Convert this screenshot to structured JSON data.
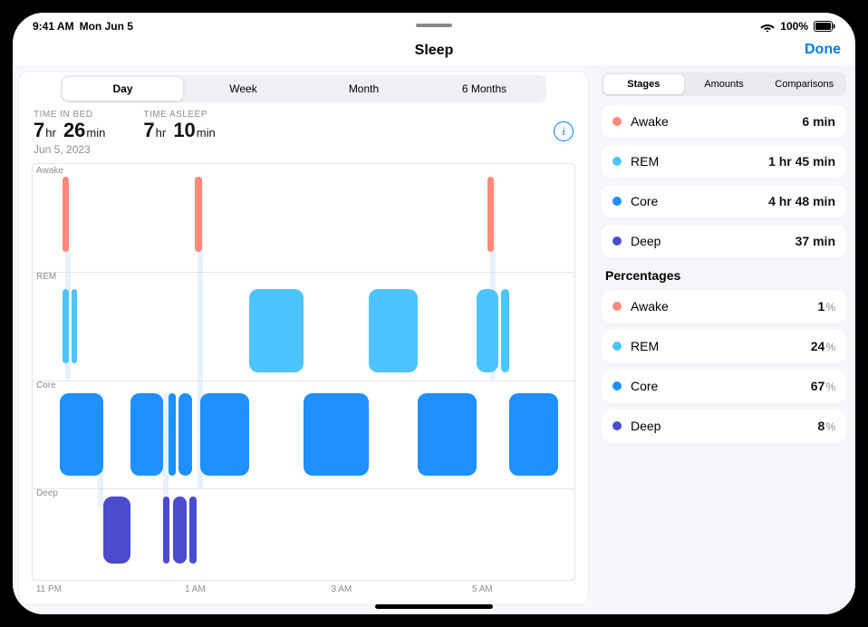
{
  "status": {
    "time": "9:41 AM",
    "date": "Mon Jun 5",
    "battery": "100%"
  },
  "header": {
    "title": "Sleep",
    "done": "Done"
  },
  "range_tabs": [
    "Day",
    "Week",
    "Month",
    "6 Months"
  ],
  "range_active": 0,
  "metrics": {
    "bed_label": "TIME IN BED",
    "bed_hr": "7",
    "bed_hr_u": "hr",
    "bed_min": "26",
    "bed_min_u": "min",
    "asleep_label": "TIME ASLEEP",
    "asleep_hr": "7",
    "asleep_hr_u": "hr",
    "asleep_min": "10",
    "asleep_min_u": "min",
    "date": "Jun 5, 2023"
  },
  "axis": {
    "ylabels": [
      "Awake",
      "REM",
      "Core",
      "Deep"
    ],
    "xlabels": [
      "11 PM",
      "1 AM",
      "3 AM",
      "5 AM"
    ]
  },
  "side_tabs": [
    "Stages",
    "Amounts",
    "Comparisons"
  ],
  "side_active": 0,
  "stages": [
    {
      "name": "Awake",
      "color": "#ff8a7a",
      "val": "6 min"
    },
    {
      "name": "REM",
      "color": "#4dc4ff",
      "val": "1 hr 45 min"
    },
    {
      "name": "Core",
      "color": "#1e90ff",
      "val": "4 hr 48 min"
    },
    {
      "name": "Deep",
      "color": "#4b4bcf",
      "val": "37 min"
    }
  ],
  "pct_title": "Percentages",
  "percentages": [
    {
      "name": "Awake",
      "color": "#ff8a7a",
      "val": "1"
    },
    {
      "name": "REM",
      "color": "#4dc4ff",
      "val": "24"
    },
    {
      "name": "Core",
      "color": "#1e90ff",
      "val": "67"
    },
    {
      "name": "Deep",
      "color": "#4b4bcf",
      "val": "8"
    }
  ],
  "pct_unit": "%",
  "chart_data": {
    "type": "timeline-stage",
    "title": "Sleep",
    "x_start": "23:00",
    "x_end": "06:30",
    "stages_order": [
      "Awake",
      "REM",
      "Core",
      "Deep"
    ],
    "xticks": [
      "11 PM",
      "1 AM",
      "3 AM",
      "5 AM"
    ],
    "segments": [
      {
        "stage": "Awake",
        "start": "23:10",
        "end": "23:13"
      },
      {
        "stage": "REM",
        "start": "23:14",
        "end": "23:18"
      },
      {
        "stage": "Core",
        "start": "23:18",
        "end": "23:55"
      },
      {
        "stage": "Deep",
        "start": "23:55",
        "end": "00:20"
      },
      {
        "stage": "Core",
        "start": "00:20",
        "end": "00:45"
      },
      {
        "stage": "Deep",
        "start": "00:45",
        "end": "01:05"
      },
      {
        "stage": "Core",
        "start": "01:05",
        "end": "01:12"
      },
      {
        "stage": "Awake",
        "start": "01:12",
        "end": "01:15"
      },
      {
        "stage": "Core",
        "start": "01:15",
        "end": "01:55"
      },
      {
        "stage": "REM",
        "start": "01:55",
        "end": "02:40"
      },
      {
        "stage": "Core",
        "start": "02:40",
        "end": "03:30"
      },
      {
        "stage": "REM",
        "start": "03:30",
        "end": "04:05"
      },
      {
        "stage": "Core",
        "start": "04:05",
        "end": "04:50"
      },
      {
        "stage": "REM",
        "start": "04:50",
        "end": "05:15"
      },
      {
        "stage": "Awake",
        "start": "05:15",
        "end": "05:18"
      },
      {
        "stage": "REM",
        "start": "05:18",
        "end": "05:28"
      },
      {
        "stage": "Core",
        "start": "05:28",
        "end": "06:20"
      }
    ]
  }
}
